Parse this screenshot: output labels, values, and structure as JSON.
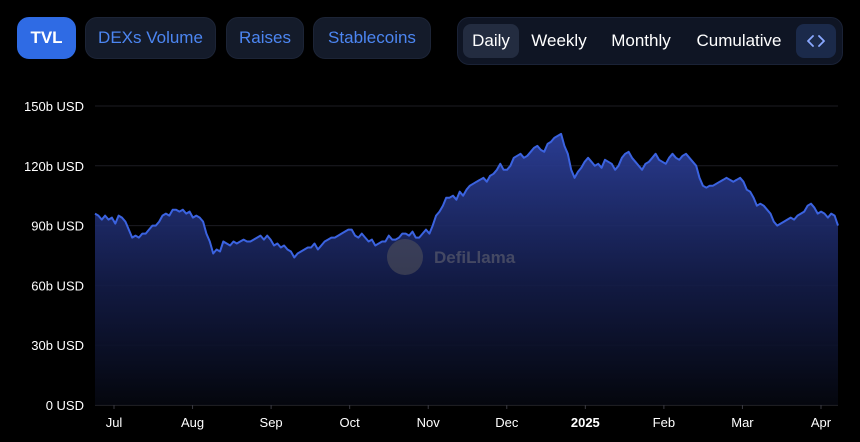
{
  "tabs": [
    {
      "label": "TVL",
      "active": true
    },
    {
      "label": "DEXs Volume",
      "active": false
    },
    {
      "label": "Raises",
      "active": false
    },
    {
      "label": "Stablecoins",
      "active": false
    }
  ],
  "ranges": [
    {
      "label": "Daily",
      "active": true
    },
    {
      "label": "Weekly",
      "active": false
    },
    {
      "label": "Monthly",
      "active": false
    },
    {
      "label": "Cumulative",
      "active": false
    }
  ],
  "embed_icon": "code-brackets-icon",
  "watermark": "DefiLlama",
  "colors": {
    "line": "#3b63e0",
    "fill_top": "#2c3f99",
    "accent": "#2f6be4"
  },
  "chart_data": {
    "type": "area",
    "ylabel_unit": "USD",
    "ylim": [
      0,
      150
    ],
    "yticks": [
      {
        "v": 0,
        "label": "0 USD"
      },
      {
        "v": 30,
        "label": "30b USD"
      },
      {
        "v": 60,
        "label": "60b USD"
      },
      {
        "v": 90,
        "label": "90b USD"
      },
      {
        "v": 120,
        "label": "120b USD"
      },
      {
        "v": 150,
        "label": "150b USD"
      }
    ],
    "xticks": [
      {
        "label": "Jul",
        "bold": false
      },
      {
        "label": "Aug",
        "bold": false
      },
      {
        "label": "Sep",
        "bold": false
      },
      {
        "label": "Oct",
        "bold": false
      },
      {
        "label": "Nov",
        "bold": false
      },
      {
        "label": "Dec",
        "bold": false
      },
      {
        "label": "2025",
        "bold": true
      },
      {
        "label": "Feb",
        "bold": false
      },
      {
        "label": "Mar",
        "bold": false
      },
      {
        "label": "Apr",
        "bold": false
      }
    ],
    "grid": true,
    "series": [
      {
        "values": [
          96,
          95,
          93,
          95,
          93,
          94,
          91,
          95,
          94,
          92,
          88,
          84,
          85,
          84,
          86,
          86,
          88,
          90,
          90,
          92,
          95,
          96,
          95,
          98,
          98,
          97,
          98,
          96,
          97,
          94,
          95,
          94,
          92,
          86,
          82,
          76,
          78,
          77,
          82,
          81,
          80,
          82,
          81,
          82,
          83,
          82,
          82,
          83,
          84,
          85,
          83,
          85,
          83,
          80,
          81,
          79,
          80,
          78,
          77,
          74,
          76,
          77,
          78,
          79,
          79,
          81,
          78,
          80,
          82,
          83,
          84,
          84,
          85,
          86,
          87,
          88,
          88,
          85,
          84,
          86,
          84,
          82,
          83,
          80,
          81,
          82,
          82,
          85,
          83,
          83,
          84,
          86,
          86,
          85,
          87,
          84,
          84,
          86,
          88,
          86,
          90,
          95,
          97,
          100,
          104,
          104,
          105,
          103,
          107,
          105,
          108,
          110,
          111,
          112,
          113,
          114,
          112,
          115,
          116,
          118,
          121,
          118,
          118,
          120,
          124,
          125,
          126,
          124,
          125,
          127,
          129,
          130,
          128,
          127,
          131,
          132,
          134,
          135,
          136,
          130,
          126,
          118,
          114,
          117,
          119,
          122,
          124,
          122,
          120,
          121,
          119,
          123,
          122,
          121,
          118,
          120,
          124,
          126,
          127,
          124,
          122,
          120,
          118,
          121,
          122,
          124,
          126,
          123,
          122,
          121,
          124,
          126,
          124,
          123,
          125,
          126,
          124,
          122,
          120,
          114,
          110,
          109,
          110,
          110,
          111,
          112,
          113,
          114,
          113,
          112,
          113,
          114,
          112,
          108,
          107,
          104,
          100,
          101,
          100,
          98,
          96,
          92,
          90,
          91,
          92,
          93,
          94,
          93,
          95,
          96,
          97,
          100,
          101,
          99,
          96,
          97,
          96,
          94,
          96,
          95,
          90
        ]
      }
    ]
  }
}
